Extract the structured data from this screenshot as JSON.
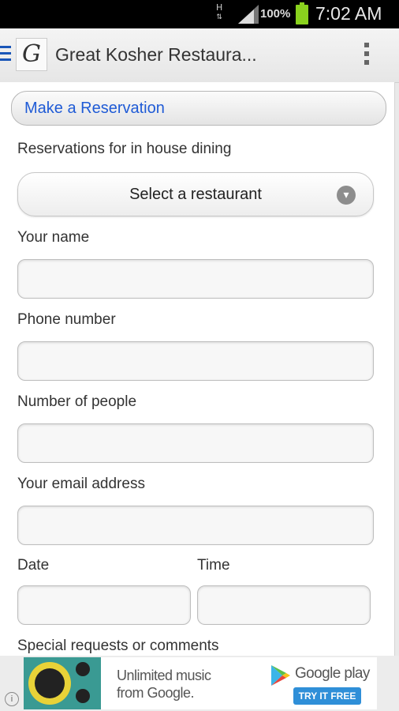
{
  "status_bar": {
    "network_type": "H",
    "battery_percent": "100%",
    "time": "7:02 AM"
  },
  "action_bar": {
    "logo_letter": "G",
    "title": "Great Kosher Restaura..."
  },
  "form": {
    "section_title": "Make a Reservation",
    "intro": "Reservations for in house dining",
    "restaurant_select": "Select a restaurant",
    "name_label": "Your name",
    "phone_label": "Phone number",
    "people_label": "Number of people",
    "email_label": "Your email address",
    "date_label": "Date",
    "time_label": "Time",
    "comments_label": "Special requests or comments",
    "name_value": "",
    "phone_value": "",
    "people_value": "",
    "email_value": "",
    "date_value": "",
    "time_value": ""
  },
  "ad": {
    "headline": "Unlimited music from Google.",
    "brand": "Google play",
    "cta": "TRY IT FREE",
    "info_icon": "i"
  },
  "icons": {
    "menu": "hamburger-icon",
    "overflow": "overflow-menu-icon",
    "dropdown": "chevron-down-icon",
    "info": "info-icon",
    "signal": "signal-icon",
    "battery": "battery-icon"
  },
  "colors": {
    "accent": "#1f5bd6",
    "status_bar": "#000000",
    "battery": "#8ad21e",
    "ad_button": "#2f8fd8"
  }
}
